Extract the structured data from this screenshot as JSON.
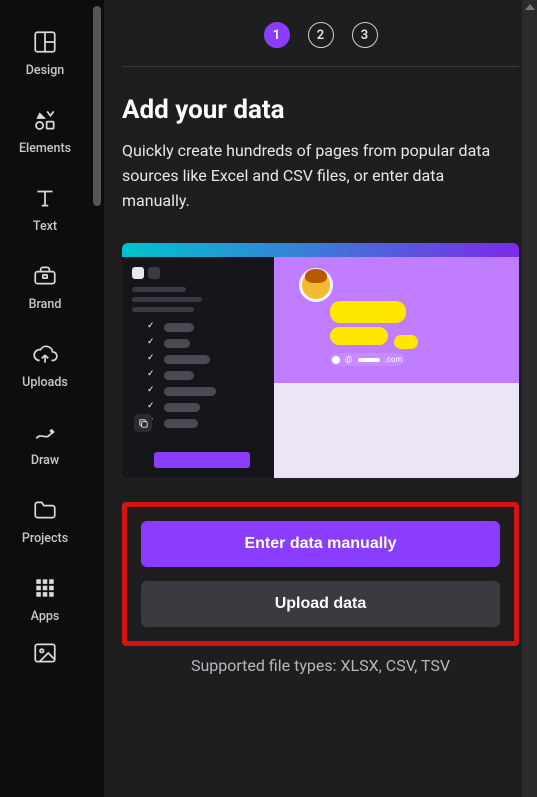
{
  "sidebar": {
    "items": [
      {
        "id": "design",
        "label": "Design"
      },
      {
        "id": "elements",
        "label": "Elements"
      },
      {
        "id": "text",
        "label": "Text"
      },
      {
        "id": "brand",
        "label": "Brand"
      },
      {
        "id": "uploads",
        "label": "Uploads"
      },
      {
        "id": "draw",
        "label": "Draw"
      },
      {
        "id": "projects",
        "label": "Projects"
      },
      {
        "id": "apps",
        "label": "Apps"
      }
    ]
  },
  "steps": {
    "s1": "1",
    "s2": "2",
    "s3": "3"
  },
  "heading": "Add your data",
  "description": "Quickly create hundreds of pages from popular data sources like Excel and CSV files, or enter data manually.",
  "illustration": {
    "email_fragment": ".com"
  },
  "buttons": {
    "enter_manually": "Enter data manually",
    "upload_data": "Upload data"
  },
  "supported_text": "Supported file types: XLSX, CSV, TSV"
}
